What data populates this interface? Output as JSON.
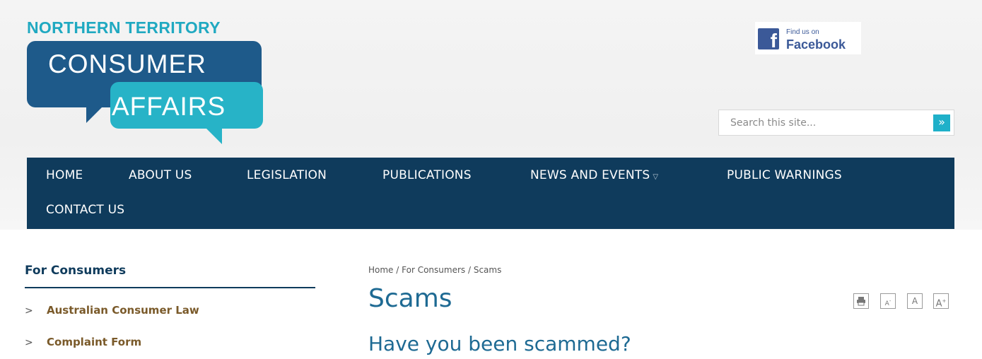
{
  "header": {
    "logo": {
      "line1": "NORTHERN TERRITORY",
      "line2": "CONSUMER",
      "line3": "AFFAIRS"
    },
    "facebook": {
      "small": "Find us on",
      "big": "Facebook",
      "icon": "facebook-icon"
    },
    "search": {
      "placeholder": "Search this site...",
      "button_icon": "arrow-right-icon"
    }
  },
  "nav": {
    "items": [
      {
        "label": "HOME"
      },
      {
        "label": "ABOUT US"
      },
      {
        "label": "LEGISLATION"
      },
      {
        "label": "PUBLICATIONS"
      },
      {
        "label": "NEWS AND EVENTS"
      },
      {
        "label": "PUBLIC WARNINGS"
      },
      {
        "label": "CONTACT US"
      }
    ]
  },
  "sidebar": {
    "title": "For Consumers",
    "items": [
      {
        "label": "Australian Consumer Law"
      },
      {
        "label": "Complaint Form"
      }
    ]
  },
  "main": {
    "breadcrumb": [
      "Home",
      "For Consumers",
      "Scams"
    ],
    "title": "Scams",
    "subtitle": "Have you been scammed?",
    "tools": {
      "font_decrease": "A",
      "font_normal": "A",
      "font_increase": "A"
    }
  },
  "colors": {
    "nav_bg": "#0f3b5c",
    "brand_dark": "#1e5a8a",
    "brand_light": "#27b3c7",
    "heading": "#1e6a93",
    "facebook": "#3b5998"
  }
}
